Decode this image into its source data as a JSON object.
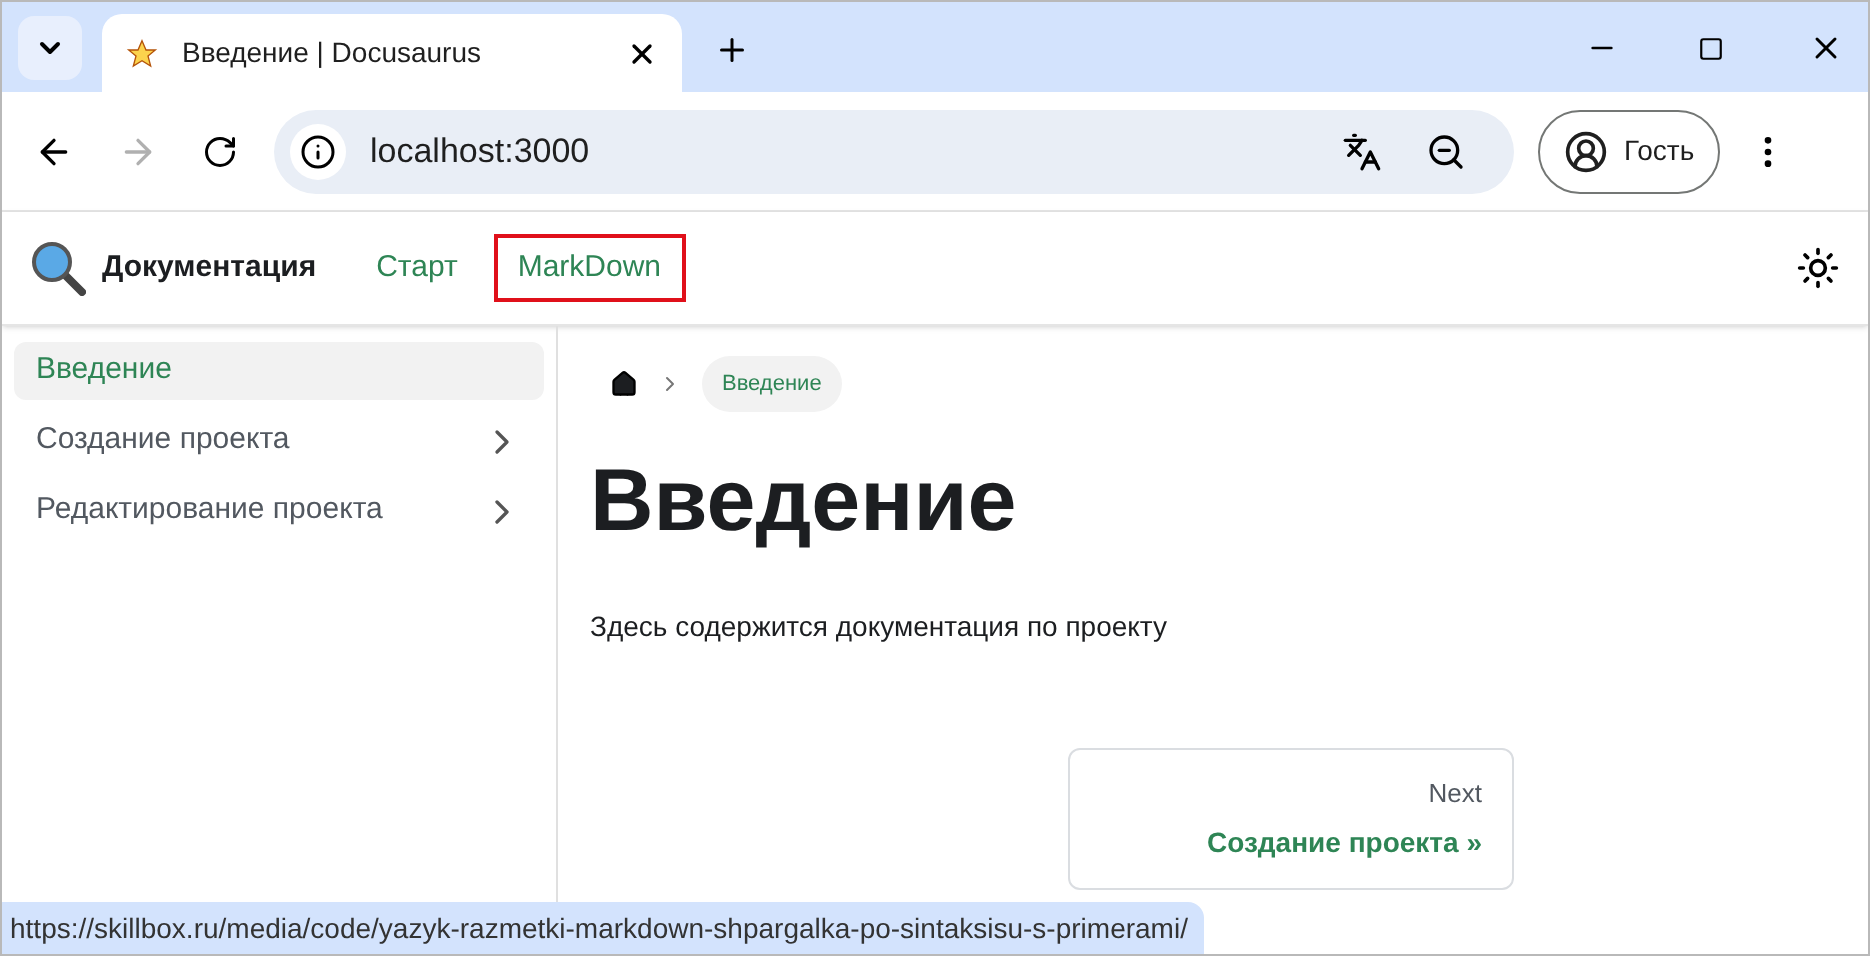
{
  "browser": {
    "tab": {
      "title": "Введение | Docusaurus",
      "selected": true
    },
    "address": "localhost:3000",
    "profile": "Гость",
    "forward_disabled": true
  },
  "navbar": {
    "title": "Документация",
    "links": [
      {
        "label": "Старт",
        "outlined": false
      },
      {
        "label": "MarkDown",
        "outlined": true
      }
    ]
  },
  "sidebar": {
    "items": [
      {
        "label": "Введение",
        "selected": true,
        "expandable": false
      },
      {
        "label": "Создание проекта",
        "selected": false,
        "expandable": true
      },
      {
        "label": "Редактирование проекта",
        "selected": false,
        "expandable": true
      }
    ]
  },
  "breadcrumb": {
    "current": "Введение"
  },
  "page": {
    "heading": "Введение",
    "body": "Здесь содержится документация по проекту"
  },
  "pagination": {
    "label": "Next",
    "title": "Создание проекта »"
  },
  "status_bar": {
    "url": "https://skillbox.ru/media/code/yazyk-razmetki-markdown-shpargalka-po-sintaksisu-s-primerami/"
  }
}
